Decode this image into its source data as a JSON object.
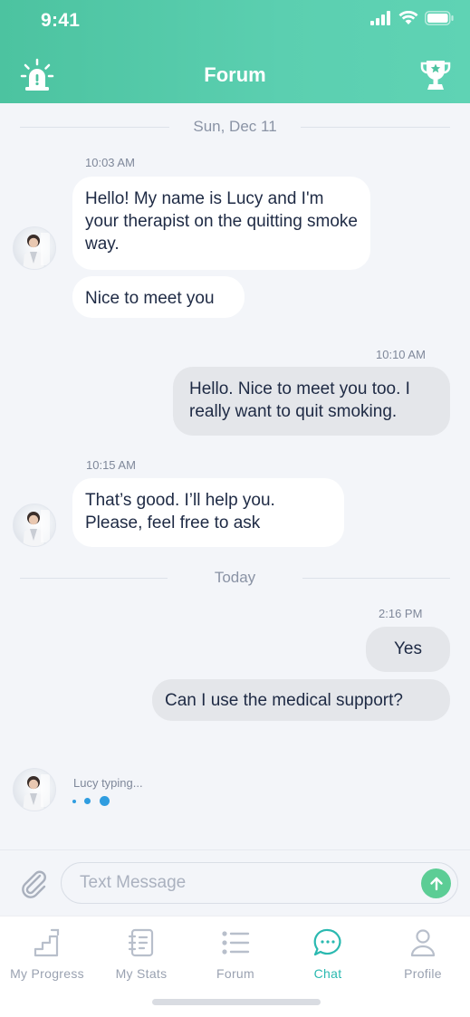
{
  "status_bar": {
    "time": "9:41"
  },
  "header": {
    "title": "Forum"
  },
  "conversation": {
    "date_1": "Sun, Dec 11",
    "date_2": "Today",
    "groups": [
      {
        "time": "10:03 AM",
        "messages": [
          "Hello! My name is Lucy and I'm your therapist on the quitting smoke way.",
          "Nice to meet you"
        ]
      },
      {
        "time": "10:10 AM",
        "messages": [
          "Hello. Nice to meet you too. I really want to quit smoking."
        ]
      },
      {
        "time": "10:15 AM",
        "messages": [
          "That’s good. I’ll help you. Please, feel free to ask"
        ]
      },
      {
        "time": "2:16 PM",
        "messages": [
          "Yes",
          "Can I use the medical support?"
        ]
      }
    ],
    "typing": "Lucy typing..."
  },
  "composer": {
    "placeholder": "Text Message"
  },
  "tabs": [
    {
      "label": "My Progress",
      "icon": "stairs-icon"
    },
    {
      "label": "My Stats",
      "icon": "notebook-icon"
    },
    {
      "label": "Forum",
      "icon": "list-icon"
    },
    {
      "label": "Chat",
      "icon": "chat-bubble-icon"
    },
    {
      "label": "Profile",
      "icon": "person-icon"
    }
  ],
  "colors": {
    "accent": "#4cc3a0",
    "active_tab": "#2ab9b0",
    "typing_dot": "#2f9de0",
    "send": "#5ccd95"
  }
}
